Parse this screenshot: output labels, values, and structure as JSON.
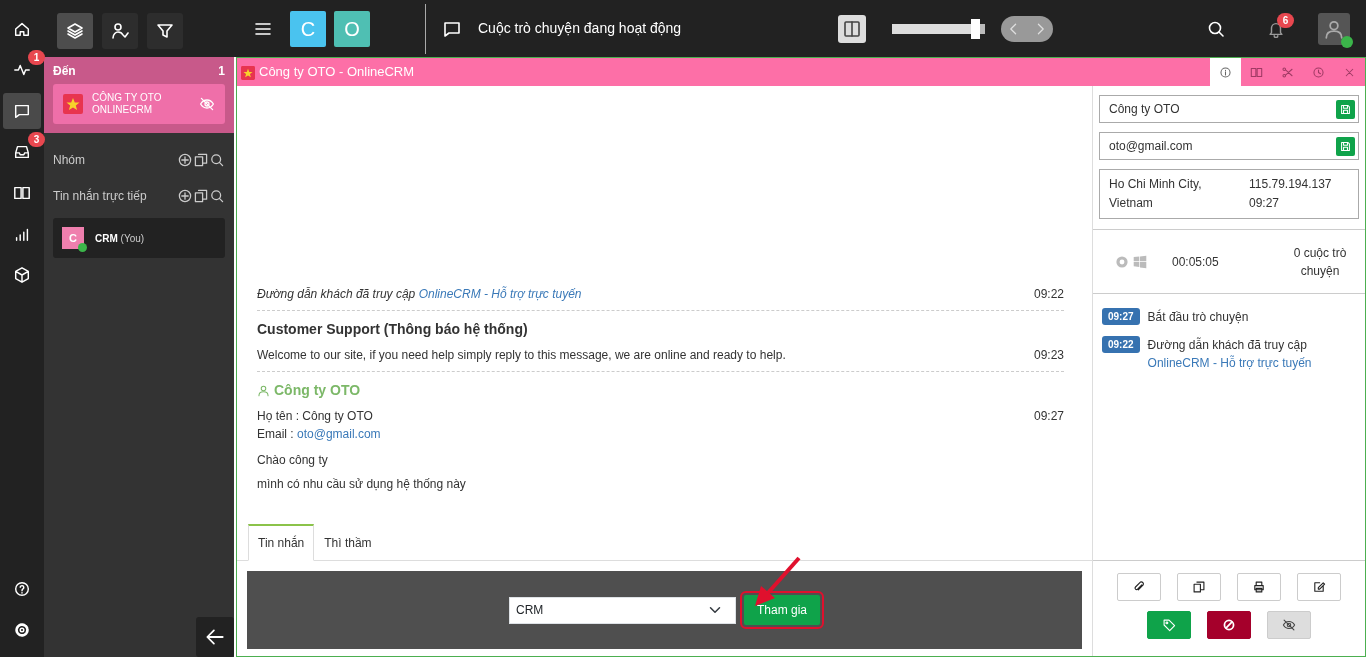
{
  "rail": {
    "items": [
      {
        "kind": "home",
        "selected": false
      },
      {
        "kind": "activity",
        "badge": "1",
        "selected": false
      },
      {
        "kind": "chat",
        "selected": true
      },
      {
        "kind": "inbox",
        "badge": "3",
        "selected": false
      },
      {
        "kind": "book",
        "selected": false
      },
      {
        "kind": "chart",
        "selected": false
      },
      {
        "kind": "box",
        "selected": false
      }
    ],
    "bottom_items": [
      {
        "kind": "help"
      },
      {
        "kind": "settings"
      }
    ]
  },
  "sidebar": {
    "tools": [
      {
        "kind": "layers",
        "selected": true
      },
      {
        "kind": "user-check",
        "selected": false
      },
      {
        "kind": "filter",
        "selected": false
      }
    ],
    "incoming": {
      "title": "Đến",
      "count": "1",
      "items": [
        {
          "name": "CÔNG TY OTO ONLINECRM"
        }
      ]
    },
    "sections": [
      {
        "title": "Nhóm"
      },
      {
        "title": "Tin nhắn trực tiếp",
        "items": [
          {
            "avatar": "C",
            "name": "CRM",
            "suffix": "(You)",
            "online": true
          }
        ]
      }
    ]
  },
  "topbar": {
    "logos": [
      {
        "letter": "C",
        "color": "#4ac3ef"
      },
      {
        "letter": "O",
        "color": "#4fbfb3"
      }
    ],
    "title": "Cuộc trò chuyện đang hoạt động",
    "slider": {
      "level": 0.95
    },
    "notifications": "6",
    "user_online": true
  },
  "conversation": {
    "title": "Công ty OTO - OnlineCRM",
    "header_tabs": [
      {
        "kind": "info",
        "selected": true
      },
      {
        "kind": "book",
        "selected": false
      },
      {
        "kind": "scissors",
        "selected": false
      },
      {
        "kind": "clock",
        "selected": false
      },
      {
        "kind": "close",
        "selected": false
      }
    ],
    "messages": [
      {
        "kind": "visit",
        "text": "Đường dẫn khách đã truy cập",
        "link": "OnlineCRM - Hỗ trợ trực tuyến",
        "time": "09:22"
      },
      {
        "kind": "system",
        "sender": "Customer Support (Thông báo hệ thống)",
        "lines": [
          "Welcome to our site, if you need help simply reply to this message, we are online and ready to help."
        ],
        "time": "09:23"
      },
      {
        "kind": "visitor",
        "sender": "Công ty OTO",
        "details": [
          {
            "label": "Họ tên : ",
            "value": "Công ty OTO"
          },
          {
            "label": "Email : ",
            "link": "oto@gmail.com"
          }
        ],
        "lines": [
          "Chào công ty",
          "mình có nhu cầu sử dụng hệ thống này"
        ],
        "time": "09:27"
      }
    ],
    "composer": {
      "tabs": [
        {
          "label": "Tin nhắn",
          "selected": true
        },
        {
          "label": "Thì thầm",
          "selected": false
        }
      ],
      "select_value": "CRM",
      "button": "Tham gia",
      "highlighted": true
    }
  },
  "info": {
    "fields": [
      {
        "value": "Công ty OTO"
      },
      {
        "value": "oto@gmail.com"
      }
    ],
    "location": "Ho Chi Minh City, Vietnam",
    "ip": "115.79.194.137",
    "time": "09:27",
    "duration": "00:05:05",
    "chat_count": "0 cuộc trò chuyện",
    "timeline": [
      {
        "time": "09:27",
        "text": "Bắt đầu trò chuyện"
      },
      {
        "time": "09:22",
        "text": "Đường dẫn khách đã truy cập",
        "link": "OnlineCRM - Hỗ trợ trực tuyến"
      }
    ],
    "actions": [
      {
        "kind": "paperclip"
      },
      {
        "kind": "copy"
      },
      {
        "kind": "print"
      },
      {
        "kind": "edit"
      }
    ],
    "actions_2": [
      {
        "kind": "tag"
      },
      {
        "kind": "ban"
      },
      {
        "kind": "eye-off"
      }
    ]
  }
}
